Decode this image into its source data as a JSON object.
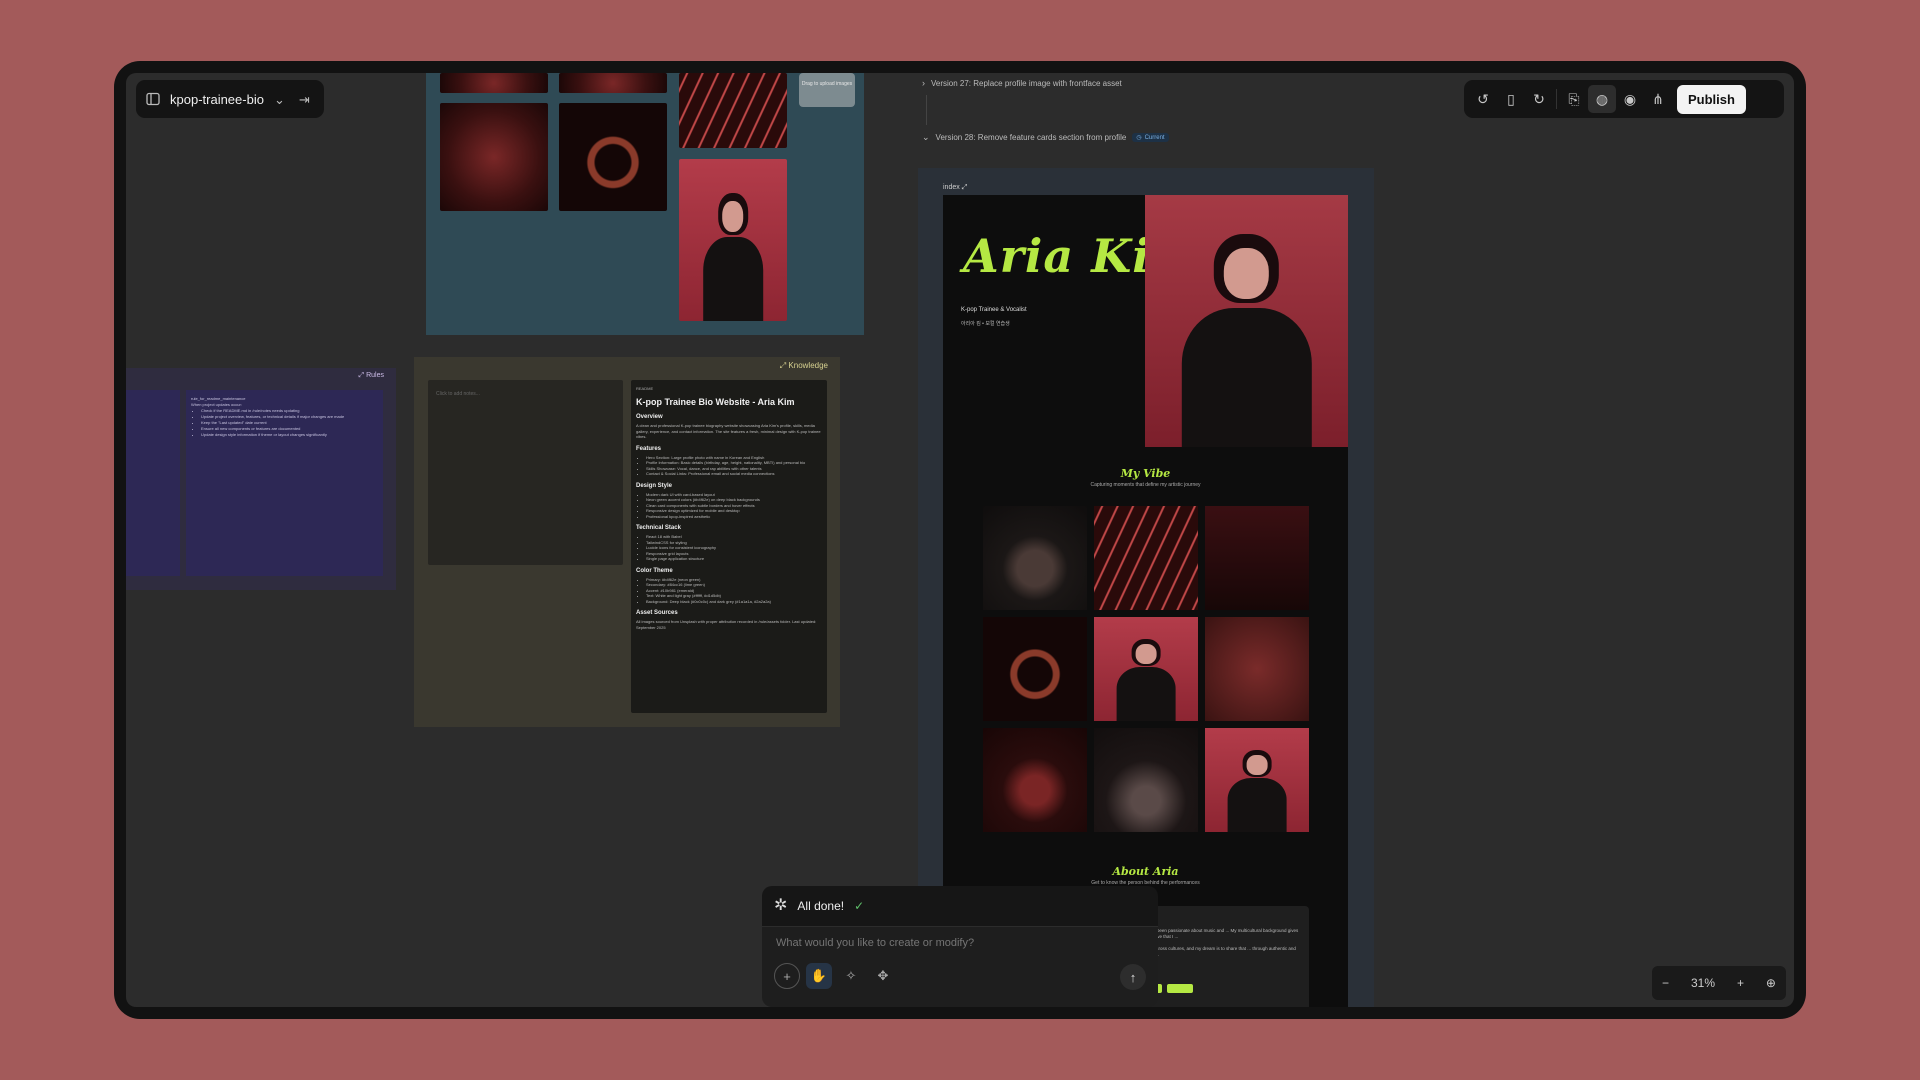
{
  "project": {
    "name": "kpop-trainee-bio"
  },
  "image_board": {
    "drop_text": "Drag to upload images"
  },
  "rules": {
    "badge": "Rules",
    "heading": "rule_for_readme_maintenance",
    "intro": "When project updates occur:",
    "items": [
      "Check if the README.md in /rule/notes needs updating",
      "Update project overview, features, or technical details if major changes are made",
      "Keep the \"Last updated\" date current",
      "Ensure all new components or features are documented",
      "Update design style information if theme or layout changes significantly"
    ]
  },
  "knowledge": {
    "badge": "Knowledge",
    "notes_placeholder": "Click to add notes...",
    "readme": {
      "label": "README",
      "title": "K-pop Trainee Bio Website - Aria Kim",
      "sections": [
        {
          "heading": "Overview",
          "text": "A clean and professional K-pop trainee biography website showcasing Aria Kim's profile, skills, media gallery, experience, and contact information. The site features a fresh, minimal design with K-pop trainee vibes."
        },
        {
          "heading": "Features",
          "items": [
            "Hero Section: Large profile photo with name in Korean and English",
            "Profile Information: Basic details (birthday, age, height, nationality, MBTI) and personal bio",
            "Skills Showcase: Vocal, dance, and rap abilities with other talents",
            "Contact & Social Links: Professional email and social media connections"
          ]
        },
        {
          "heading": "Design Style",
          "items": [
            "Modern dark UI with card-based layout",
            "Neon green accent colors (#b4f62e) on deep black backgrounds",
            "Clean card components with subtle borders and hover effects",
            "Responsive design optimized for mobile and desktop",
            "Professional kpop-inspired aesthetic"
          ]
        },
        {
          "heading": "Technical Stack",
          "items": [
            "React 18 with Babel",
            "TailwindCSS for styling",
            "Lucide icons for consistent iconography",
            "Responsive grid layouts",
            "Single page application structure"
          ]
        },
        {
          "heading": "Color Theme",
          "items": [
            "Primary: #b4f62e (neon green)",
            "Secondary: #84cc16 (lime green)",
            "Accent: #10b981 (emerald)",
            "Text: White and light gray (#ffffff, #d1d5db)",
            "Background: Deep black (#0c0c0c) and dark grey (#1a1a1a, #2a2a2a)"
          ]
        },
        {
          "heading": "Asset Sources",
          "text": "All images sourced from Unsplash with proper attribution recorded in /rule/assets folder. Last updated: September 2025"
        }
      ]
    }
  },
  "versions": {
    "v27": "Version 27: Replace profile image with frontface asset",
    "v28": "Version 28: Remove feature cards section from profile",
    "current_badge": "Current"
  },
  "preview": {
    "tab": "index",
    "hero_name": "Aria Kim",
    "hero_subtitle": "K-pop Trainee & Vocalist",
    "hero_korean": "아리아 킴 • 보컬 연습생",
    "vibe_title": "My Vibe",
    "vibe_subtitle": "Capturing moments that define my artistic journey",
    "about_title": "About Aria",
    "about_subtitle": "Get to know the person behind the performances",
    "about_text_1": "and Los Angeles, I've been passionate about music and ... My multicultural background gives me a unique perspective that I ...",
    "about_text_2": "... to connect hearts across cultures, and my dream is to share that ... through authentic and heartfelt performances."
  },
  "toolbar": {
    "publish_label": "Publish"
  },
  "zoom": {
    "minus": "−",
    "value": "31%",
    "plus": "+"
  },
  "chat": {
    "status": "All done!",
    "placeholder": "What would you like to create or modify?"
  },
  "colors": {
    "accent_green": "#b5e843",
    "background": "#a35a5a",
    "canvas": "#2c2c2c"
  }
}
